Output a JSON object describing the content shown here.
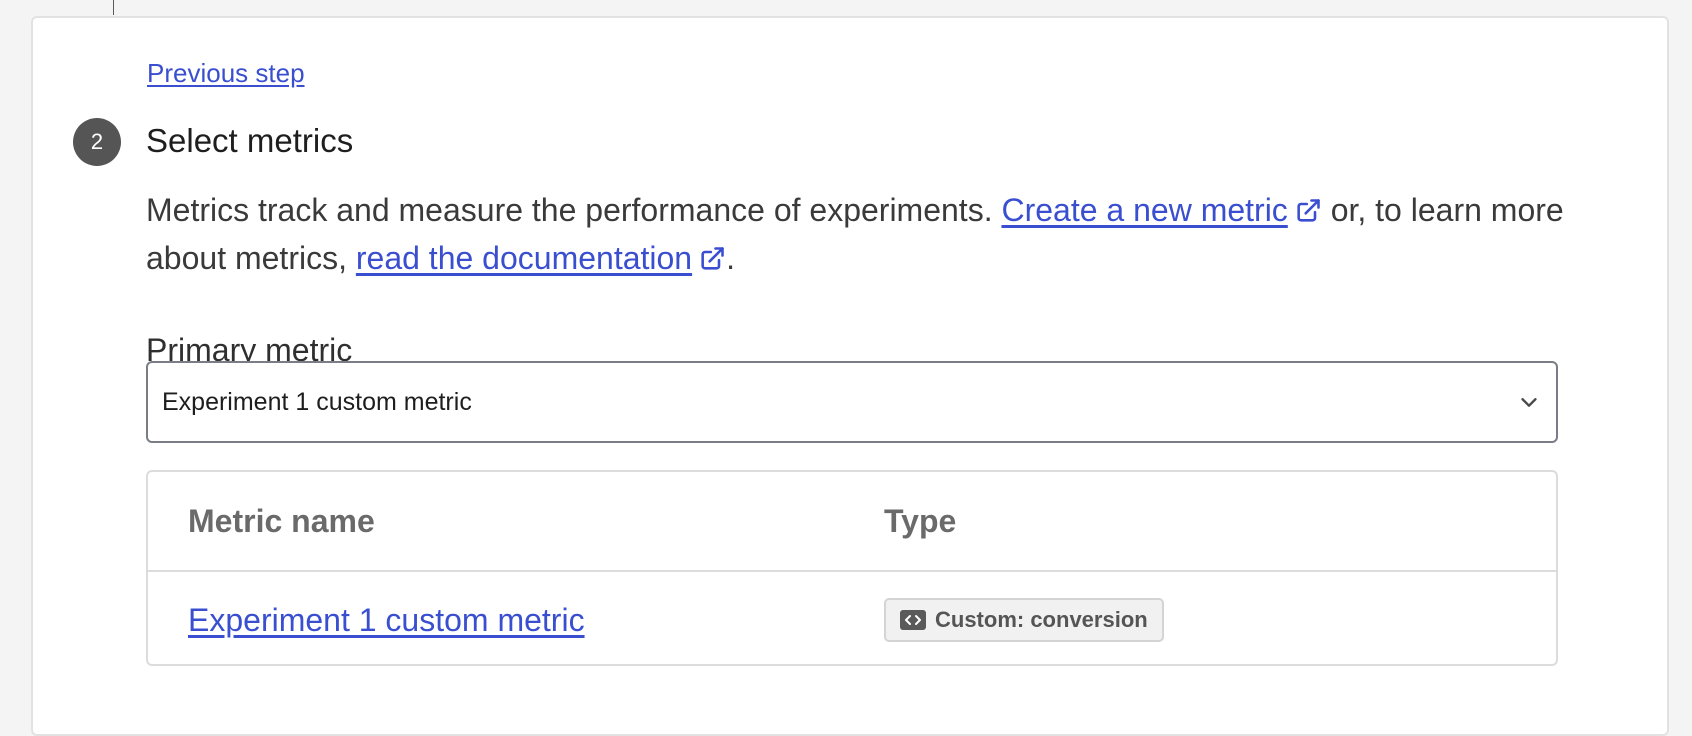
{
  "step": {
    "number": "2",
    "title": "Select metrics",
    "previous_label": "Previous step"
  },
  "description": {
    "text_before": "Metrics track and measure the performance of experiments. ",
    "create_link": "Create a new metric",
    "text_middle": " or, to learn more about metrics, ",
    "docs_link": "read the documentation",
    "text_after": "."
  },
  "primary_metric": {
    "label": "Primary metric",
    "selected": "Experiment 1 custom metric"
  },
  "table": {
    "columns": [
      "Metric name",
      "Type"
    ],
    "rows": [
      {
        "name": "Experiment 1 custom metric",
        "type": "Custom: conversion",
        "type_icon": "code-icon"
      }
    ]
  },
  "colors": {
    "link": "#3a4fd0",
    "step_circle": "#555555",
    "badge_bg": "#f1f1f1"
  },
  "icons": {
    "external_link": "external-link-icon",
    "dropdown": "chevron-down-icon",
    "type_badge": "code-icon"
  }
}
